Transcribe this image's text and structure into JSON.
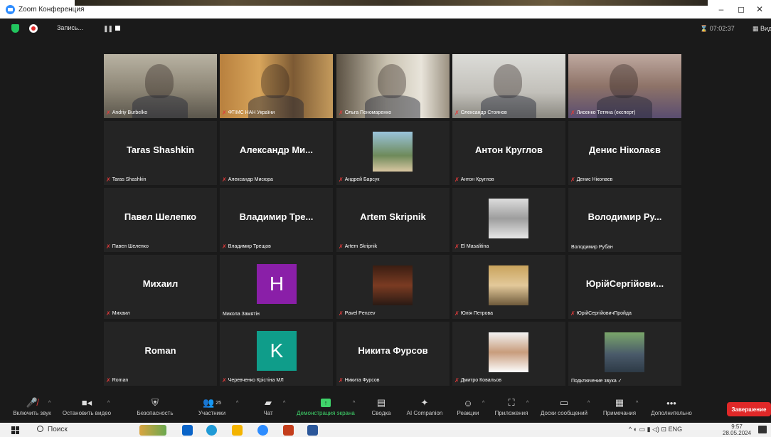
{
  "window": {
    "title": "Zoom Конференция",
    "minimize": "–",
    "maximize": "◻",
    "close": "✕"
  },
  "topbar": {
    "recording_label": "Запись...",
    "pause_glyph": "❚❚",
    "timer": "⌛ 07:02:37",
    "view_label": "▦ Вид"
  },
  "tiles": [
    {
      "display": "video",
      "caption": "Andriy Burbelko",
      "muted": true
    },
    {
      "display": "video",
      "caption": "ФТІМС НАН України",
      "muted": true,
      "active": true
    },
    {
      "display": "video",
      "caption": "Ольга Пономаренко",
      "muted": true
    },
    {
      "display": "video",
      "caption": "Олександр Стоянов",
      "muted": true
    },
    {
      "display": "video",
      "caption": "Лисенко Тетяна (експерт)",
      "muted": true
    },
    {
      "display": "name",
      "big": "Taras Shashkin",
      "caption": "Taras Shashkin",
      "muted": true
    },
    {
      "display": "name",
      "big": "Александр Ми...",
      "caption": "Александр Мисюра",
      "muted": true
    },
    {
      "display": "photo",
      "caption": "Андрей Барсук",
      "muted": true
    },
    {
      "display": "name",
      "big": "Антон Круглов",
      "caption": "Антон Круглов",
      "muted": true
    },
    {
      "display": "name",
      "big": "Денис Ніколаєв",
      "caption": "Денис Ніколаєв",
      "muted": true
    },
    {
      "display": "name",
      "big": "Павел Шелепко",
      "caption": "Павел Шелепко",
      "muted": true
    },
    {
      "display": "name",
      "big": "Владимир Тре...",
      "caption": "Владимир Трещов",
      "muted": true
    },
    {
      "display": "name",
      "big": "Artem Skripnik",
      "caption": "Artem Skripnik",
      "muted": true
    },
    {
      "display": "photo",
      "caption": "El Masalitina",
      "muted": true
    },
    {
      "display": "name",
      "big": "Володимир Ру...",
      "caption": "Володимир Рубан",
      "muted": false
    },
    {
      "display": "name",
      "big": "Михаил",
      "caption": "Михаил",
      "muted": true
    },
    {
      "display": "letter",
      "letter": "H",
      "color": "#8a1fa8",
      "caption": "Микола Замятін",
      "muted": false
    },
    {
      "display": "photo",
      "caption": "Pavel Penzev",
      "muted": true
    },
    {
      "display": "photo",
      "caption": "Юлія Петрова",
      "muted": true
    },
    {
      "display": "name",
      "big": "ЮрійСергійови...",
      "caption": "ЮрійСергійовичПройда",
      "muted": true
    },
    {
      "display": "name",
      "big": "Roman",
      "caption": "Roman",
      "muted": true
    },
    {
      "display": "letter",
      "letter": "K",
      "color": "#0f9d8a",
      "caption": "Черевченко Крістіна МЛ",
      "muted": true
    },
    {
      "display": "name",
      "big": "Никита Фурсов",
      "caption": "Никита Фурсов",
      "muted": true
    },
    {
      "display": "photo",
      "caption": "Дмитро Ковальов",
      "muted": true
    },
    {
      "display": "photo",
      "caption": "Подключение звука ✓",
      "muted": false
    }
  ],
  "toolbar": {
    "unmute": "Включить звук",
    "stop_video": "Остановить видео",
    "security": "Безопасность",
    "participants": "Участники",
    "participants_count": "25",
    "chat": "Чат",
    "share": "Демонстрация экрана",
    "summary": "Сводка",
    "ai": "AI Companion",
    "reactions": "Реакции",
    "apps": "Приложения",
    "whiteboards": "Доски сообщений",
    "notes": "Примечания",
    "more": "Дополнительно",
    "end": "Завершение",
    "share_color": "#3fd46a",
    "end_color": "#e02828"
  },
  "taskbar": {
    "search": "Поиск",
    "lang": "ENG",
    "time": "9:57",
    "date": "28.05.2024"
  }
}
